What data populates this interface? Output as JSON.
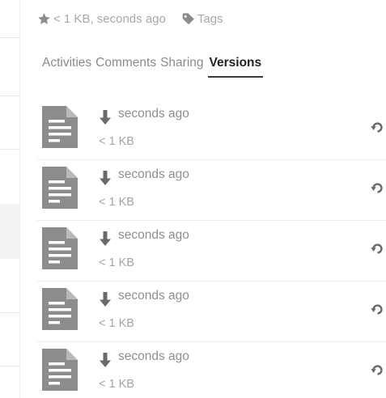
{
  "details": {
    "size_and_time": "< 1 KB, seconds ago",
    "tags_label": "Tags"
  },
  "tabs": [
    {
      "label": "Activities",
      "active": false
    },
    {
      "label": "Comments",
      "active": false
    },
    {
      "label": "Sharing",
      "active": false
    },
    {
      "label": "Versions",
      "active": true
    }
  ],
  "versions": [
    {
      "time": "seconds ago",
      "size": "< 1 KB"
    },
    {
      "time": "seconds ago",
      "size": "< 1 KB"
    },
    {
      "time": "seconds ago",
      "size": "< 1 KB"
    },
    {
      "time": "seconds ago",
      "size": "< 1 KB"
    },
    {
      "time": "seconds ago",
      "size": "< 1 KB"
    }
  ],
  "icons": {
    "star": "star-icon",
    "tag": "tag-icon",
    "file": "text-file-icon",
    "download": "download-arrow-icon",
    "restore": "restore-icon"
  },
  "colors": {
    "icon_gray": "#8c8c8c",
    "active_tab": "#222222",
    "muted_text": "#a8a8a8"
  }
}
